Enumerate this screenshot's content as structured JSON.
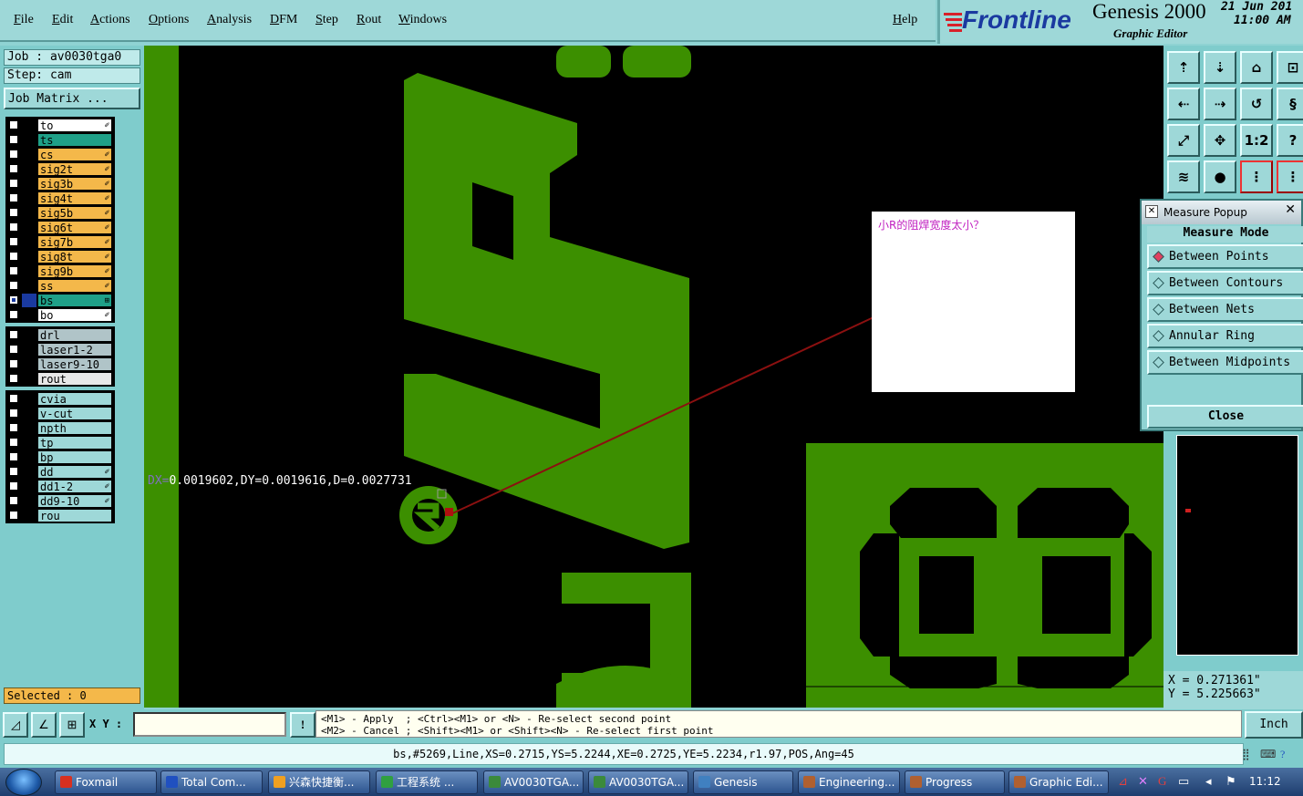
{
  "menu": {
    "items": [
      "File",
      "Edit",
      "Actions",
      "Options",
      "Analysis",
      "DFM",
      "Step",
      "Rout",
      "Windows"
    ],
    "help": "Help"
  },
  "brand": {
    "logo": "Frontline",
    "product": "Genesis 2000",
    "subtitle": "Graphic Editor",
    "date": "21 Jun 201",
    "time": "11:00 AM"
  },
  "job": {
    "job_label": "Job : av0030tga0",
    "step_label": "Step: cam",
    "matrix_button": "Job Matrix ..."
  },
  "layers_board": [
    {
      "name": "to",
      "color": "#ffffff",
      "mark": "✐"
    },
    {
      "name": "ts",
      "color": "#1fa088",
      "mark": ""
    },
    {
      "name": "cs",
      "color": "#f4b84a",
      "mark": "✐"
    },
    {
      "name": "sig2t",
      "color": "#f4b84a",
      "mark": "✐"
    },
    {
      "name": "sig3b",
      "color": "#f4b84a",
      "mark": "✐"
    },
    {
      "name": "sig4t",
      "color": "#f4b84a",
      "mark": "✐"
    },
    {
      "name": "sig5b",
      "color": "#f4b84a",
      "mark": "✐"
    },
    {
      "name": "sig6t",
      "color": "#f4b84a",
      "mark": "✐"
    },
    {
      "name": "sig7b",
      "color": "#f4b84a",
      "mark": "✐"
    },
    {
      "name": "sig8t",
      "color": "#f4b84a",
      "mark": "✐"
    },
    {
      "name": "sig9b",
      "color": "#f4b84a",
      "mark": "✐"
    },
    {
      "name": "ss",
      "color": "#f4b84a",
      "mark": "✐"
    },
    {
      "name": "bs",
      "color": "#1fa088",
      "mark": "⊞"
    },
    {
      "name": "bo",
      "color": "#ffffff",
      "mark": "✐"
    }
  ],
  "layers_drill": [
    {
      "name": "drl",
      "color": "#b0c4c8",
      "mark": ""
    },
    {
      "name": "laser1-2",
      "color": "#b0c4c8",
      "mark": ""
    },
    {
      "name": "laser9-10",
      "color": "#b0c4c8",
      "mark": ""
    },
    {
      "name": "rout",
      "color": "#e8e8e8",
      "mark": ""
    }
  ],
  "layers_misc": [
    {
      "name": "cvia",
      "color": "#9ed8d8",
      "mark": ""
    },
    {
      "name": "v-cut",
      "color": "#9ed8d8",
      "mark": ""
    },
    {
      "name": "npth",
      "color": "#9ed8d8",
      "mark": ""
    },
    {
      "name": "tp",
      "color": "#9ed8d8",
      "mark": ""
    },
    {
      "name": "bp",
      "color": "#9ed8d8",
      "mark": ""
    },
    {
      "name": "dd",
      "color": "#9ed8d8",
      "mark": "✐"
    },
    {
      "name": "dd1-2",
      "color": "#9ed8d8",
      "mark": "✐"
    },
    {
      "name": "dd9-10",
      "color": "#9ed8d8",
      "mark": "✐"
    },
    {
      "name": "rou",
      "color": "#9ed8d8",
      "mark": ""
    }
  ],
  "selected": "Selected : 0",
  "canvas": {
    "note": "小R的阻焊宽度太小？",
    "measure_prefix": "DX=",
    "measure": "0.0019602,DY=0.0019616,D=0.0027731"
  },
  "toolbox": [
    "⇡",
    "⇣",
    "⌂",
    "⊡",
    "⇠",
    "⇢",
    "↺",
    "§",
    "⤢",
    "✥",
    "1:2",
    "?",
    "≋",
    "●",
    "⋮",
    "⋮"
  ],
  "measure_popup": {
    "title": "Measure Popup",
    "mode_label": "Measure Mode",
    "options": [
      "Between Points",
      "Between Contours",
      "Between Nets",
      "Annular Ring",
      "Between Midpoints"
    ],
    "selected_index": 0,
    "close": "Close"
  },
  "coords": {
    "x": "X = 0.271361\"",
    "y": "Y = 5.225663\""
  },
  "cmd": {
    "xy_label": "X Y :",
    "xy_value": "",
    "hint_line1": "<M1> - Apply  ; <Ctrl><M1> or <N> - Re-select second point",
    "hint_line2": "<M2> - Cancel ; <Shift><M1> or <Shift><N> - Re-select first point",
    "unit": "Inch",
    "exclaim": "!"
  },
  "status_line": "bs,#5269,Line,XS=0.2715,YS=5.2244,XE=0.2725,YE=5.2234,r1.97,POS,Ang=45",
  "taskbar": {
    "tasks": [
      {
        "label": "Foxmail",
        "icon_color": "#d83020"
      },
      {
        "label": "Total Com...",
        "icon_color": "#2050c0"
      },
      {
        "label": "兴森快捷衡...",
        "icon_color": "#f0a020"
      },
      {
        "label": "工程系统  ...",
        "icon_color": "#30a040"
      },
      {
        "label": "AV0030TGA...",
        "icon_color": "#3b8a3b"
      },
      {
        "label": "AV0030TGA...",
        "icon_color": "#3b8a3b"
      },
      {
        "label": "Genesis",
        "icon_color": "#4080c0"
      },
      {
        "label": "Engineering...",
        "icon_color": "#b06030"
      },
      {
        "label": "Progress",
        "icon_color": "#b06030"
      },
      {
        "label": "Graphic Edi...",
        "icon_color": "#b06030"
      }
    ],
    "clock": "11:12"
  },
  "colors": {
    "feature_green": "#3c8f00",
    "measure_line": "#8b1010",
    "note_text": "#c020c0"
  }
}
